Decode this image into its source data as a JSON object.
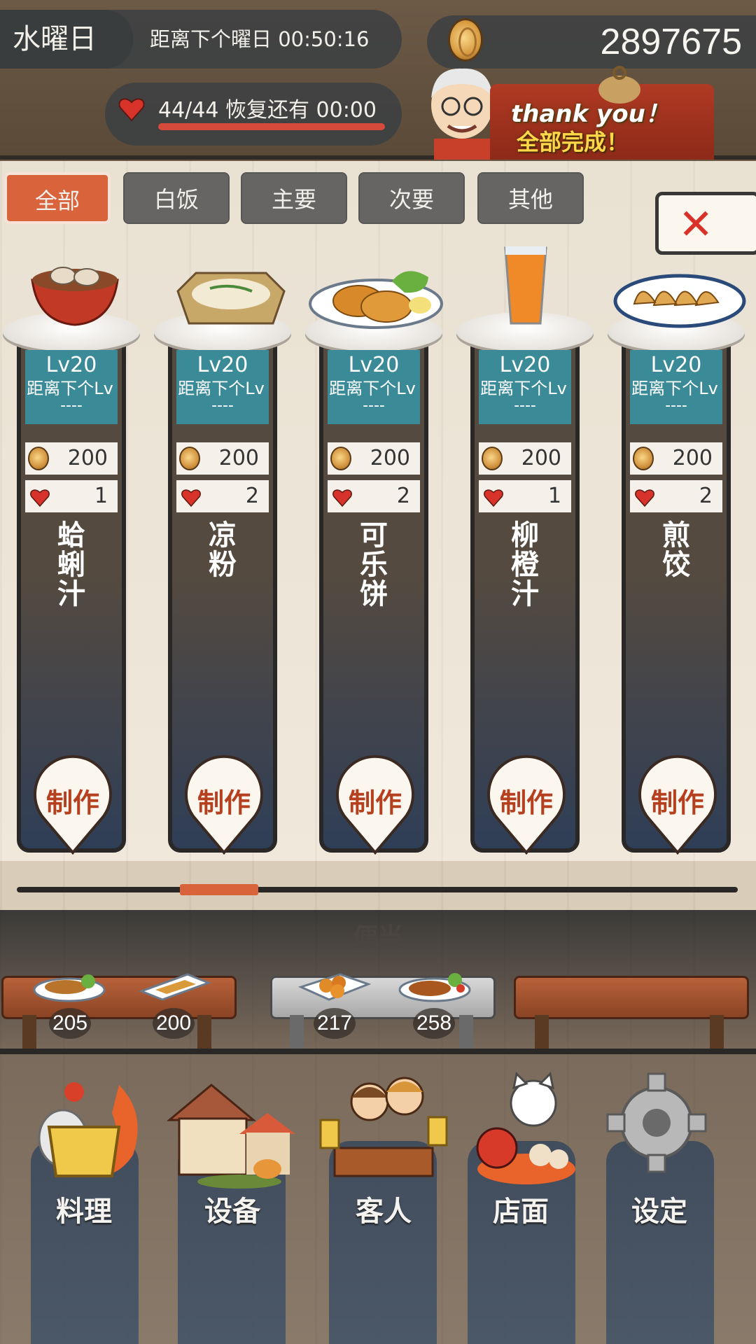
{
  "header": {
    "weekday": "水曜日",
    "countdown": "距离下个曜日  00:50:16",
    "money": "2897675",
    "stamina": "44/44  恢复还有  00:00",
    "stamina_fill": 1.0,
    "banner_line1": "thank you！",
    "banner_line2": "全部完成！"
  },
  "tabs": [
    {
      "label": "全部",
      "active": true
    },
    {
      "label": "白饭",
      "active": false
    },
    {
      "label": "主要",
      "active": false
    },
    {
      "label": "次要",
      "active": false
    },
    {
      "label": "其他",
      "active": false
    }
  ],
  "dishes": [
    {
      "lv": "Lv20",
      "next": "距离下个Lv",
      "dash": "----",
      "cost": "200",
      "likes": "1",
      "name": [
        "蛤",
        "蜊",
        "汁"
      ],
      "make": "制作",
      "food": "clam-soup-icon"
    },
    {
      "lv": "Lv20",
      "next": "距离下个Lv",
      "dash": "----",
      "cost": "200",
      "likes": "2",
      "name": [
        "凉",
        "粉"
      ],
      "make": "制作",
      "food": "cold-noodles-icon"
    },
    {
      "lv": "Lv20",
      "next": "距离下个Lv",
      "dash": "----",
      "cost": "200",
      "likes": "2",
      "name": [
        "可",
        "乐",
        "饼"
      ],
      "make": "制作",
      "food": "croquette-icon"
    },
    {
      "lv": "Lv20",
      "next": "距离下个Lv",
      "dash": "----",
      "cost": "200",
      "likes": "1",
      "name": [
        "柳",
        "橙",
        "汁"
      ],
      "make": "制作",
      "food": "orange-juice-icon"
    },
    {
      "lv": "Lv20",
      "next": "距离下个Lv",
      "dash": "----",
      "cost": "200",
      "likes": "2",
      "name": [
        "煎",
        "饺"
      ],
      "make": "制作",
      "food": "gyoza-icon"
    }
  ],
  "bento": {
    "title": "便当",
    "prices": [
      "205",
      "200",
      "217",
      "258"
    ]
  },
  "nav": [
    {
      "label": "料理",
      "icon": "cooking-pot-icon"
    },
    {
      "label": "设备",
      "icon": "house-icon"
    },
    {
      "label": "客人",
      "icon": "customers-icon"
    },
    {
      "label": "店面",
      "icon": "lucky-cat-icon"
    },
    {
      "label": "设定",
      "icon": "gear-icon"
    }
  ],
  "colors": {
    "accent": "#d9643c",
    "teal": "#3a8a98",
    "heart": "#d8332a"
  }
}
